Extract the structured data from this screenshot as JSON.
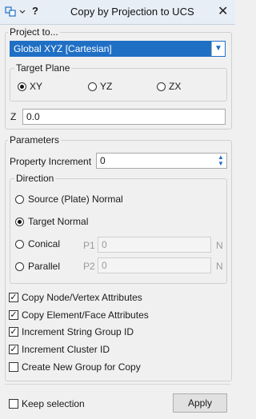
{
  "window": {
    "title": "Copy by Projection to UCS",
    "help": "?",
    "close": "✕"
  },
  "project": {
    "legend": "Project to...",
    "selected": "Global XYZ [Cartesian]",
    "target_plane": {
      "legend": "Target Plane",
      "options": [
        "XY",
        "YZ",
        "ZX"
      ],
      "selected": "XY"
    },
    "z_label": "Z",
    "z_value": "0.0"
  },
  "parameters": {
    "legend": "Parameters",
    "property_increment_label": "Property Increment",
    "property_increment_value": "0",
    "direction": {
      "legend": "Direction",
      "source_normal": "Source (Plate) Normal",
      "target_normal": "Target Normal",
      "conical": "Conical",
      "parallel": "Parallel",
      "selected": "Target Normal",
      "p1_label": "P1",
      "p1_value": "0",
      "p1_unit": "N",
      "p2_label": "P2",
      "p2_value": "0",
      "p2_unit": "N"
    }
  },
  "checks": {
    "copy_node": {
      "label": "Copy Node/Vertex Attributes",
      "checked": true
    },
    "copy_element": {
      "label": "Copy Element/Face Attributes",
      "checked": true
    },
    "inc_string": {
      "label": "Increment String Group ID",
      "checked": true
    },
    "inc_cluster": {
      "label": "Increment Cluster ID",
      "checked": true
    },
    "new_group": {
      "label": "Create New Group for Copy",
      "checked": false
    }
  },
  "footer": {
    "keep_selection": "Keep selection",
    "keep_checked": false,
    "apply": "Apply"
  }
}
